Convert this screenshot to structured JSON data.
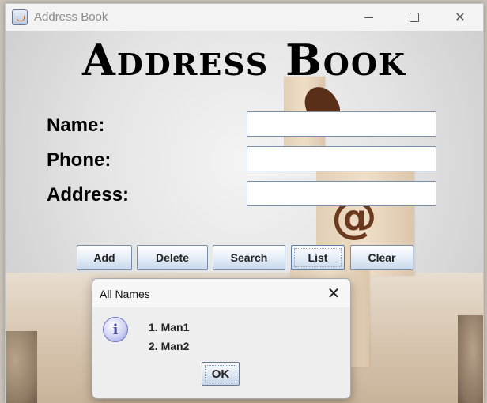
{
  "window": {
    "title": "Address Book",
    "icon": "java-cup-icon"
  },
  "app": {
    "heading": "Address Book",
    "fields": {
      "name_label": "Name:",
      "phone_label": "Phone:",
      "address_label": "Address:",
      "name_value": "",
      "phone_value": "",
      "address_value": ""
    },
    "buttons": {
      "add": "Add",
      "delete": "Delete",
      "search": "Search",
      "list": "List",
      "clear": "Clear"
    }
  },
  "dialog": {
    "title": "All Names",
    "icon": "info-icon",
    "lines": [
      "1. Man1",
      "2. Man2"
    ],
    "ok_label": "OK"
  }
}
